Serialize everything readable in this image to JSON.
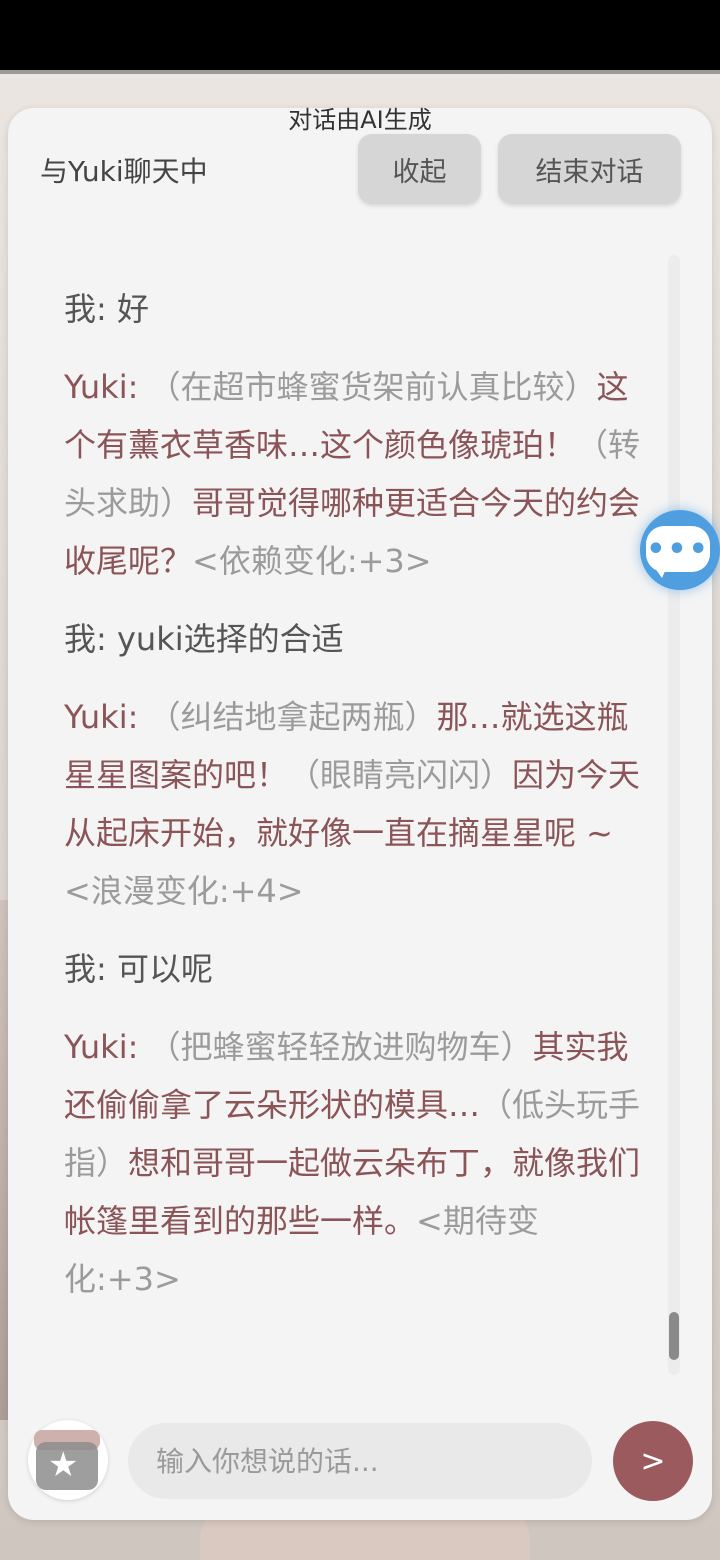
{
  "header": {
    "ai_notice": "对话由AI生成",
    "title": "与Yuki聊天中",
    "collapse_label": "收起",
    "end_label": "结束对话"
  },
  "messages": [
    {
      "speaker": "我: ",
      "text": "好"
    },
    {
      "speaker": "Yuki: ",
      "action1": "（在超市蜂蜜货架前认真比较）",
      "text1": "这个有薰衣草香味…这个颜色像琥珀！",
      "action2": "（转头求助）",
      "text2": "哥哥觉得哪种更适合今天的约会收尾呢？",
      "change": "<依赖变化:+3>"
    },
    {
      "speaker": "我: ",
      "text": "yuki选择的合适"
    },
    {
      "speaker": "Yuki: ",
      "action1": "（纠结地拿起两瓶）",
      "text1": "那…就选这瓶星星图案的吧！",
      "action2": "（眼睛亮闪闪）",
      "text2": "因为今天从起床开始，就好像一直在摘星星呢 ~ ",
      "change": "<浪漫变化:+4>"
    },
    {
      "speaker": "我: ",
      "text": "可以呢"
    },
    {
      "speaker": "Yuki: ",
      "action1": "（把蜂蜜轻轻放进购物车）",
      "text1": "其实我还偷偷拿了云朵形状的模具…",
      "action2": "（低头玩手指）",
      "text2": "想和哥哥一起做云朵布丁，就像我们帐篷里看到的那些一样。",
      "change": "<期待变化:+3>"
    }
  ],
  "input": {
    "placeholder": "输入你想说的话...",
    "value": ""
  },
  "send": {
    "label": ">"
  },
  "icons": {
    "float": "chat-bubble-icon",
    "gift": "gift-star-icon"
  },
  "colors": {
    "accent": "#9a5a5e",
    "yuki_text": "#8b5457",
    "action_text": "#9b9b9b",
    "float_button": "#4f9fe0"
  }
}
